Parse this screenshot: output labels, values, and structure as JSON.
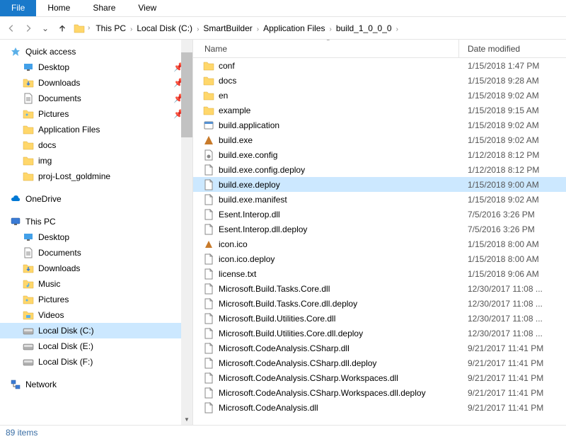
{
  "ribbon": {
    "file": "File",
    "home": "Home",
    "share": "Share",
    "view": "View"
  },
  "breadcrumb": [
    "This PC",
    "Local Disk (C:)",
    "SmartBuilder",
    "Application Files",
    "build_1_0_0_0"
  ],
  "sidebar": {
    "quick_access": "Quick access",
    "quick_items": [
      {
        "label": "Desktop",
        "pinned": true,
        "icon": "desktop"
      },
      {
        "label": "Downloads",
        "pinned": true,
        "icon": "downloads"
      },
      {
        "label": "Documents",
        "pinned": true,
        "icon": "documents"
      },
      {
        "label": "Pictures",
        "pinned": true,
        "icon": "pictures"
      },
      {
        "label": "Application Files",
        "pinned": false,
        "icon": "folder"
      },
      {
        "label": "docs",
        "pinned": false,
        "icon": "folder"
      },
      {
        "label": "img",
        "pinned": false,
        "icon": "folder"
      },
      {
        "label": "proj-Lost_goldmine",
        "pinned": false,
        "icon": "folder"
      }
    ],
    "onedrive": "OneDrive",
    "this_pc": "This PC",
    "pc_items": [
      {
        "label": "Desktop",
        "icon": "desktop"
      },
      {
        "label": "Documents",
        "icon": "documents"
      },
      {
        "label": "Downloads",
        "icon": "downloads"
      },
      {
        "label": "Music",
        "icon": "music"
      },
      {
        "label": "Pictures",
        "icon": "pictures"
      },
      {
        "label": "Videos",
        "icon": "videos"
      },
      {
        "label": "Local Disk (C:)",
        "icon": "disk",
        "selected": true
      },
      {
        "label": "Local Disk (E:)",
        "icon": "disk"
      },
      {
        "label": "Local Disk (F:)",
        "icon": "disk"
      }
    ],
    "network": "Network"
  },
  "columns": {
    "name": "Name",
    "date": "Date modified"
  },
  "files": [
    {
      "name": "conf",
      "date": "1/15/2018 1:47 PM",
      "icon": "folder"
    },
    {
      "name": "docs",
      "date": "1/15/2018 9:28 AM",
      "icon": "folder"
    },
    {
      "name": "en",
      "date": "1/15/2018 9:02 AM",
      "icon": "folder"
    },
    {
      "name": "example",
      "date": "1/15/2018 9:15 AM",
      "icon": "folder"
    },
    {
      "name": "build.application",
      "date": "1/15/2018 9:02 AM",
      "icon": "app"
    },
    {
      "name": "build.exe",
      "date": "1/15/2018 9:02 AM",
      "icon": "exe"
    },
    {
      "name": "build.exe.config",
      "date": "1/12/2018 8:12 PM",
      "icon": "config"
    },
    {
      "name": "build.exe.config.deploy",
      "date": "1/12/2018 8:12 PM",
      "icon": "file"
    },
    {
      "name": "build.exe.deploy",
      "date": "1/15/2018 9:00 AM",
      "icon": "file",
      "selected": true
    },
    {
      "name": "build.exe.manifest",
      "date": "1/15/2018 9:02 AM",
      "icon": "file"
    },
    {
      "name": "Esent.Interop.dll",
      "date": "7/5/2016 3:26 PM",
      "icon": "file"
    },
    {
      "name": "Esent.Interop.dll.deploy",
      "date": "7/5/2016 3:26 PM",
      "icon": "file"
    },
    {
      "name": "icon.ico",
      "date": "1/15/2018 8:00 AM",
      "icon": "ico"
    },
    {
      "name": "icon.ico.deploy",
      "date": "1/15/2018 8:00 AM",
      "icon": "file"
    },
    {
      "name": "license.txt",
      "date": "1/15/2018 9:06 AM",
      "icon": "file"
    },
    {
      "name": "Microsoft.Build.Tasks.Core.dll",
      "date": "12/30/2017 11:08 ...",
      "icon": "file"
    },
    {
      "name": "Microsoft.Build.Tasks.Core.dll.deploy",
      "date": "12/30/2017 11:08 ...",
      "icon": "file"
    },
    {
      "name": "Microsoft.Build.Utilities.Core.dll",
      "date": "12/30/2017 11:08 ...",
      "icon": "file"
    },
    {
      "name": "Microsoft.Build.Utilities.Core.dll.deploy",
      "date": "12/30/2017 11:08 ...",
      "icon": "file"
    },
    {
      "name": "Microsoft.CodeAnalysis.CSharp.dll",
      "date": "9/21/2017 11:41 PM",
      "icon": "file"
    },
    {
      "name": "Microsoft.CodeAnalysis.CSharp.dll.deploy",
      "date": "9/21/2017 11:41 PM",
      "icon": "file"
    },
    {
      "name": "Microsoft.CodeAnalysis.CSharp.Workspaces.dll",
      "date": "9/21/2017 11:41 PM",
      "icon": "file"
    },
    {
      "name": "Microsoft.CodeAnalysis.CSharp.Workspaces.dll.deploy",
      "date": "9/21/2017 11:41 PM",
      "icon": "file"
    },
    {
      "name": "Microsoft.CodeAnalysis.dll",
      "date": "9/21/2017 11:41 PM",
      "icon": "file"
    }
  ],
  "status": "89 items"
}
